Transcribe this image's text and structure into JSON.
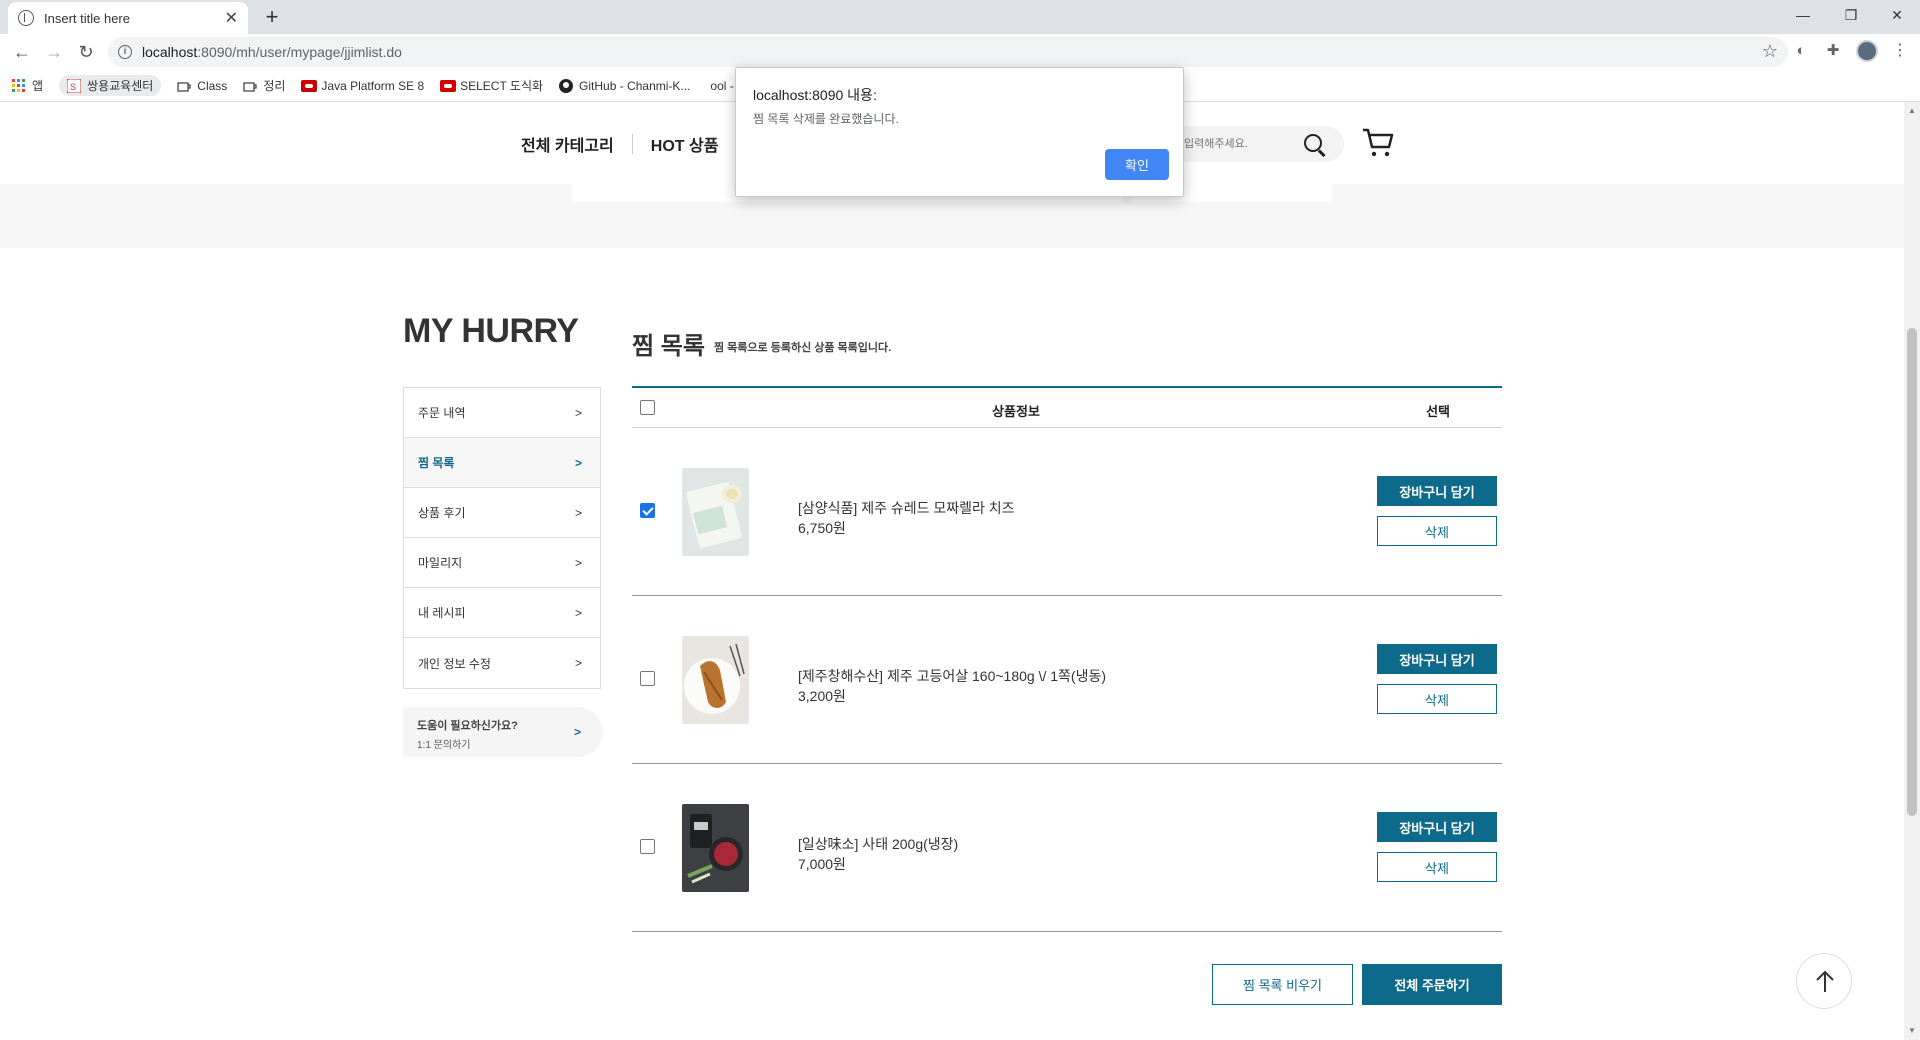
{
  "browser": {
    "tab_title": "Insert title here",
    "url_host": "localhost",
    "url_path": ":8090/mh/user/mypage/jjimlist.do",
    "bookmarks": [
      {
        "label": "앱",
        "icon": "apps-grid-icon"
      },
      {
        "label": "쌍용교육센터",
        "icon": "site-icon"
      },
      {
        "label": "Class",
        "icon": "class-icon"
      },
      {
        "label": "정리",
        "icon": "notes-icon"
      },
      {
        "label": "Java Platform SE 8",
        "icon": "oracle-icon"
      },
      {
        "label": "SELECT 도식화",
        "icon": "oracle-icon"
      },
      {
        "label": "GitHub - Chanmi-K...",
        "icon": "github-icon"
      },
      {
        "label": "ool - AQu...",
        "icon": "bookmark-icon"
      }
    ]
  },
  "alert": {
    "title": "localhost:8090 내용:",
    "message": "찜 목록 삭제를 완료했습니다.",
    "ok_label": "확인"
  },
  "header": {
    "nav": [
      "전체 카테고리",
      "HOT 상품"
    ],
    "search_placeholder": "입력해주세요."
  },
  "sidebar": {
    "title": "MY HURRY",
    "items": [
      {
        "label": "주문 내역",
        "arrow": ">"
      },
      {
        "label": "찜 목록",
        "arrow": ">"
      },
      {
        "label": "상품 후기",
        "arrow": ">"
      },
      {
        "label": "마일리지",
        "arrow": ">"
      },
      {
        "label": "내 레시피",
        "arrow": ">"
      },
      {
        "label": "개인 정보 수정",
        "arrow": ">"
      }
    ],
    "help_title": "도움이 필요하신가요?",
    "help_sub": "1:1 문의하기",
    "help_arrow": ">"
  },
  "main": {
    "title": "찜 목록",
    "subtitle": "찜 목록으로 등록하신 상품 목록입니다.",
    "columns": {
      "info": "상품정보",
      "select": "선택"
    },
    "items": [
      {
        "name": "[삼양식품] 제주 슈레드 모짜렐라 치즈",
        "price": "6,750원",
        "checked": true
      },
      {
        "name": "[제주창해수산] 제주 고등어살 160~180g \\/ 1쪽(냉동)",
        "price": "3,200원",
        "checked": false
      },
      {
        "name": "[일상味소] 사태 200g(냉장)",
        "price": "7,000원",
        "checked": false
      }
    ],
    "cart_label": "장바구니 담기",
    "delete_label": "삭제",
    "clear_label": "찜 목록 비우기",
    "order_all_label": "전체 주문하기"
  },
  "colors": {
    "accent": "#0e6a8a",
    "alert_button": "#4285f4"
  }
}
